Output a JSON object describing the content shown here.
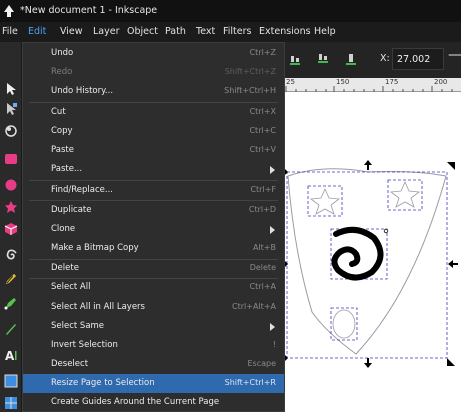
{
  "window": {
    "title": "*New document 1 - Inkscape"
  },
  "menubar": [
    {
      "label": "File",
      "active": false
    },
    {
      "label": "Edit",
      "active": true
    },
    {
      "label": "View",
      "active": false
    },
    {
      "label": "Layer",
      "active": false
    },
    {
      "label": "Object",
      "active": false
    },
    {
      "label": "Path",
      "active": false
    },
    {
      "label": "Text",
      "active": false
    },
    {
      "label": "Filters",
      "active": false
    },
    {
      "label": "Extensions",
      "active": false
    },
    {
      "label": "Help",
      "active": false
    }
  ],
  "toolbar": {
    "x_label": "X:",
    "x_value": "27.002",
    "trailing": "—"
  },
  "ruler": {
    "labels": [
      "25",
      "150",
      "175",
      "200"
    ]
  },
  "edit_menu": [
    {
      "label": "Undo",
      "shortcut": "Ctrl+Z",
      "disabled": false
    },
    {
      "label": "Redo",
      "shortcut": "Shift+Ctrl+Z",
      "disabled": true
    },
    {
      "label": "Undo History...",
      "shortcut": "Shift+Ctrl+H",
      "disabled": false
    },
    {
      "label": "Cut",
      "shortcut": "Ctrl+X",
      "disabled": false
    },
    {
      "label": "Copy",
      "shortcut": "Ctrl+C",
      "disabled": false
    },
    {
      "label": "Paste",
      "shortcut": "Ctrl+V",
      "disabled": false
    },
    {
      "label": "Paste...",
      "shortcut": "",
      "submenu": true,
      "disabled": false
    },
    {
      "label": "Find/Replace...",
      "shortcut": "Ctrl+F",
      "disabled": false
    },
    {
      "label": "Duplicate",
      "shortcut": "Ctrl+D",
      "disabled": false
    },
    {
      "label": "Clone",
      "shortcut": "",
      "submenu": true,
      "disabled": false
    },
    {
      "label": "Make a Bitmap Copy",
      "shortcut": "Alt+B",
      "disabled": false
    },
    {
      "label": "Delete",
      "shortcut": "Delete",
      "disabled": false
    },
    {
      "label": "Select All",
      "shortcut": "Ctrl+A",
      "disabled": false
    },
    {
      "label": "Select All in All Layers",
      "shortcut": "Ctrl+Alt+A",
      "disabled": false
    },
    {
      "label": "Select Same",
      "shortcut": "",
      "submenu": true,
      "disabled": false
    },
    {
      "label": "Invert Selection",
      "shortcut": "!",
      "disabled": false
    },
    {
      "label": "Deselect",
      "shortcut": "Escape",
      "disabled": false
    },
    {
      "label": "Resize Page to Selection",
      "shortcut": "Shift+Ctrl+R",
      "disabled": false,
      "highlighted": true
    },
    {
      "label": "Create Guides Around the Current Page",
      "shortcut": "",
      "disabled": false
    }
  ],
  "tools": [
    "selector-tool-icon",
    "node-tool-icon",
    "tweak-tool-icon",
    "rectangle-tool-icon",
    "circle-tool-icon",
    "star-tool-icon",
    "3d-box-tool-icon",
    "spiral-tool-icon",
    "pencil-tool-icon",
    "pen-tool-icon",
    "calligraphy-tool-icon",
    "text-tool-icon",
    "gradient-tool-icon",
    "mesh-tool-icon"
  ],
  "colors": {
    "accent": "#2f6aae",
    "active_menu": "#4f9ff5",
    "menu_bg": "#2d2d2d",
    "titlebar_bg": "#111111",
    "selection_dash": "#3b3bc4"
  }
}
